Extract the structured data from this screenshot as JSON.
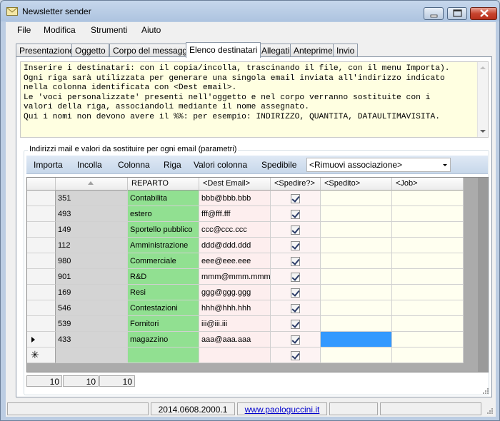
{
  "window": {
    "title": "Newsletter sender"
  },
  "menu": [
    "File",
    "Modifica",
    "Strumenti",
    "Aiuto"
  ],
  "tabs": [
    "Presentazione",
    "Oggetto",
    "Corpo del messaggio",
    "Elenco destinatari",
    "Allegati",
    "Anteprime",
    "Invio"
  ],
  "notes": [
    "Inserire i destinatari: con il copia/incolla, trascinando il file, con il menu Importa).",
    "Ogni riga sarà utilizzata per generare una singola email inviata all'indirizzo indicato",
    "nella colonna identificata con <Dest email>.",
    "Le 'voci personalizzate' presenti nell'oggetto e nel corpo verranno sostituite con i",
    "valori della riga, associandoli mediante il nome assegnato.",
    "Qui i nomi non devono avere il %%: per esempio: INDIRIZZO, QUANTITA, DATAULTIMAVISITA."
  ],
  "group_label": "Indirizzi mail e valori da sostituire per ogni email (parametri)",
  "toolbar": {
    "items": [
      "Importa",
      "Incolla",
      "Colonna",
      "Riga",
      "Valori colonna",
      "Spedibile"
    ],
    "combo_value": "<Rimuovi associazione>"
  },
  "grid": {
    "headers": [
      "",
      "REPARTO",
      "<Dest Email>",
      "<Spedire?>",
      "<Spedito>",
      "<Job>"
    ],
    "rows": [
      {
        "num": "351",
        "reparto": "Contabilita",
        "email": "bbb@bbb.bbb",
        "spedire": true
      },
      {
        "num": "493",
        "reparto": "estero",
        "email": "fff@fff.fff",
        "spedire": true
      },
      {
        "num": "149",
        "reparto": "Sportello pubblico",
        "email": "ccc@ccc.ccc",
        "spedire": true
      },
      {
        "num": "112",
        "reparto": "Amministrazione",
        "email": "ddd@ddd.ddd",
        "spedire": true
      },
      {
        "num": "980",
        "reparto": "Commerciale",
        "email": "eee@eee.eee",
        "spedire": true
      },
      {
        "num": "901",
        "reparto": "R&D",
        "email": "mmm@mmm.mmm",
        "spedire": true
      },
      {
        "num": "169",
        "reparto": "Resi",
        "email": "ggg@ggg.ggg",
        "spedire": true
      },
      {
        "num": "546",
        "reparto": "Contestazioni",
        "email": "hhh@hhh.hhh",
        "spedire": true
      },
      {
        "num": "539",
        "reparto": "Fornitori",
        "email": "iii@iii.iii",
        "spedire": true
      },
      {
        "num": "433",
        "reparto": "magazzino",
        "email": "aaa@aaa.aaa",
        "spedire": true
      }
    ],
    "new_row_marker": "✳"
  },
  "counters": [
    "10",
    "10",
    "10"
  ],
  "status": {
    "version": "2014.0608.2000.1",
    "link": "www.paologuccini.it"
  }
}
